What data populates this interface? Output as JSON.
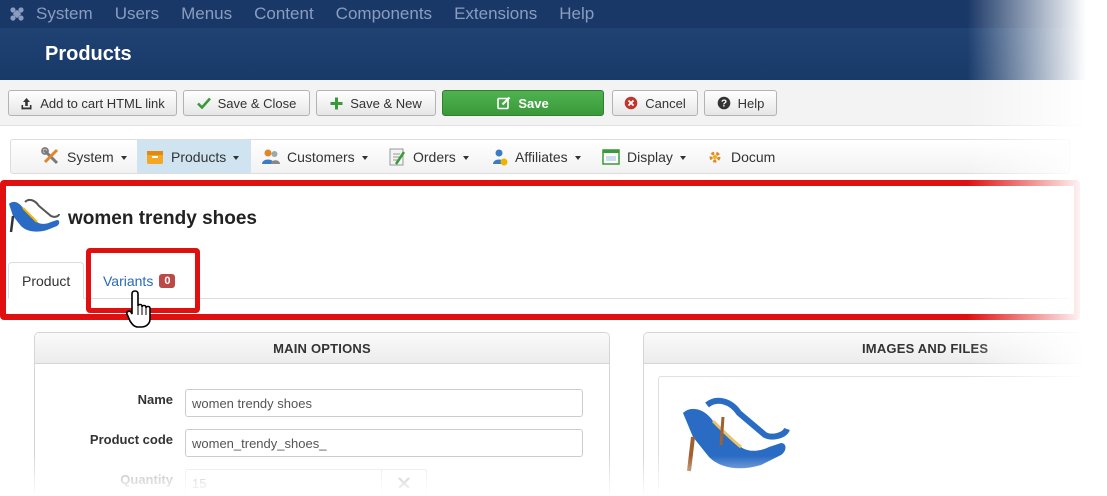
{
  "menubar": {
    "items": [
      "System",
      "Users",
      "Menus",
      "Content",
      "Components",
      "Extensions",
      "Help"
    ]
  },
  "header": {
    "title": "Products"
  },
  "toolbar": {
    "add_to_cart": "Add to cart HTML link",
    "save_close": "Save & Close",
    "save_new": "Save & New",
    "save": "Save",
    "cancel": "Cancel",
    "help": "Help"
  },
  "nav": {
    "items": [
      {
        "label": "System",
        "icon": "tools-icon",
        "dropdown": true
      },
      {
        "label": "Products",
        "icon": "box-icon",
        "dropdown": true,
        "active": true
      },
      {
        "label": "Customers",
        "icon": "users-icon",
        "dropdown": true
      },
      {
        "label": "Orders",
        "icon": "orders-icon",
        "dropdown": true
      },
      {
        "label": "Affiliates",
        "icon": "affiliates-icon",
        "dropdown": true
      },
      {
        "label": "Display",
        "icon": "display-icon",
        "dropdown": true
      },
      {
        "label": "Docum",
        "icon": "docs-icon",
        "dropdown": false
      }
    ]
  },
  "product": {
    "name": "women trendy shoes",
    "tabs": {
      "product": "Product",
      "variants": "Variants",
      "variants_count": "0"
    }
  },
  "main_options": {
    "heading": "MAIN OPTIONS",
    "name_label": "Name",
    "name_value": "women trendy shoes",
    "code_label": "Product code",
    "code_value": "women_trendy_shoes_",
    "quantity_label": "Quantity",
    "quantity_value": "15"
  },
  "images": {
    "heading": "IMAGES AND FILES"
  },
  "colors": {
    "menubar": "#1a3867",
    "save_green": "#3a9a3a",
    "highlight_red": "#e01010",
    "active_nav": "#cfe3f0",
    "link_blue": "#2a69b8"
  }
}
